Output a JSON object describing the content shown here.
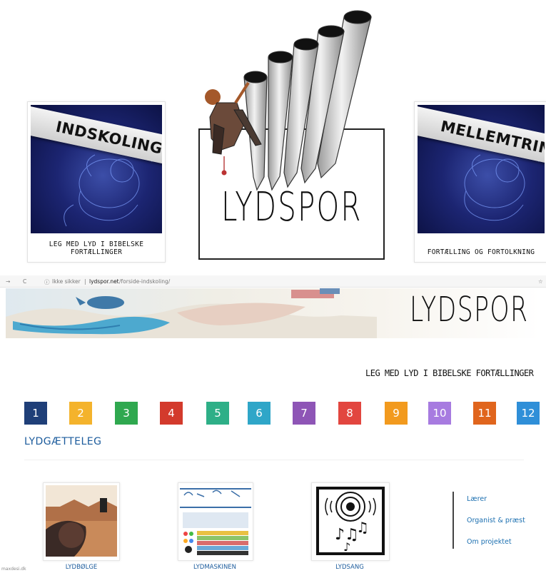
{
  "top_cards": {
    "left": {
      "title": "INDSKOLING",
      "caption": "LEG MED LYD I BIBELSKE FORTÆLLINGER"
    },
    "right": {
      "title": "MELLEMTRIN",
      "caption": "FORTÆLLING OG FORTOLKNING"
    }
  },
  "logo": {
    "text": "LYDSPOR"
  },
  "browser": {
    "security": "Ikke sikker",
    "url_domain": "lydspor.net",
    "url_path": "/forside-indskoling/"
  },
  "site": {
    "banner_logo": "LYDSPOR",
    "tagline": "LEG MED LYD I BIBELSKE FORTÆLLINGER",
    "numbers": [
      {
        "label": "1",
        "color": "#1f3f78"
      },
      {
        "label": "2",
        "color": "#f4b32c"
      },
      {
        "label": "3",
        "color": "#2fa84f"
      },
      {
        "label": "4",
        "color": "#d33a2c"
      },
      {
        "label": "5",
        "color": "#2eaf87"
      },
      {
        "label": "6",
        "color": "#2fa6c8"
      },
      {
        "label": "7",
        "color": "#8e55b6"
      },
      {
        "label": "8",
        "color": "#e2463f"
      },
      {
        "label": "9",
        "color": "#f29a1e"
      },
      {
        "label": "10",
        "color": "#a77be0"
      },
      {
        "label": "11",
        "color": "#e0651d"
      },
      {
        "label": "12",
        "color": "#2f8fd8"
      }
    ],
    "section_title": "LYDGÆTTELEG",
    "tools": [
      {
        "label": "LYDBØLGE"
      },
      {
        "label": "LYDMASKINEN"
      },
      {
        "label": "LYDSANG"
      }
    ],
    "side_links": [
      "Lærer",
      "Organist & præst",
      "Om projektet"
    ],
    "footer_fragment": "maxdesi.dk"
  }
}
